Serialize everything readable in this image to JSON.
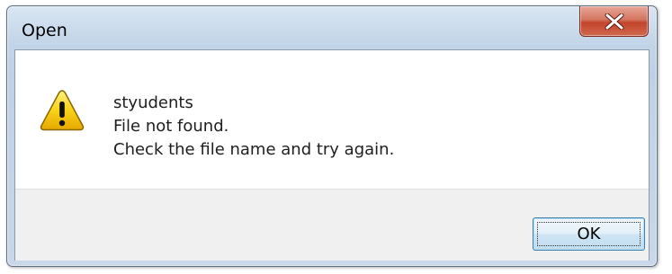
{
  "window": {
    "title": "Open",
    "close_label": "X"
  },
  "message": {
    "icon": "warning-icon",
    "filename": "styudents",
    "line1": "File not found.",
    "line2": "Check the file name and try again."
  },
  "buttons": {
    "ok_label": "OK"
  },
  "colors": {
    "title_bar": "#c3d5e8",
    "close_button": "#c4442c",
    "warning_yellow": "#f5c400",
    "ok_button_border": "#3c7fb1"
  }
}
